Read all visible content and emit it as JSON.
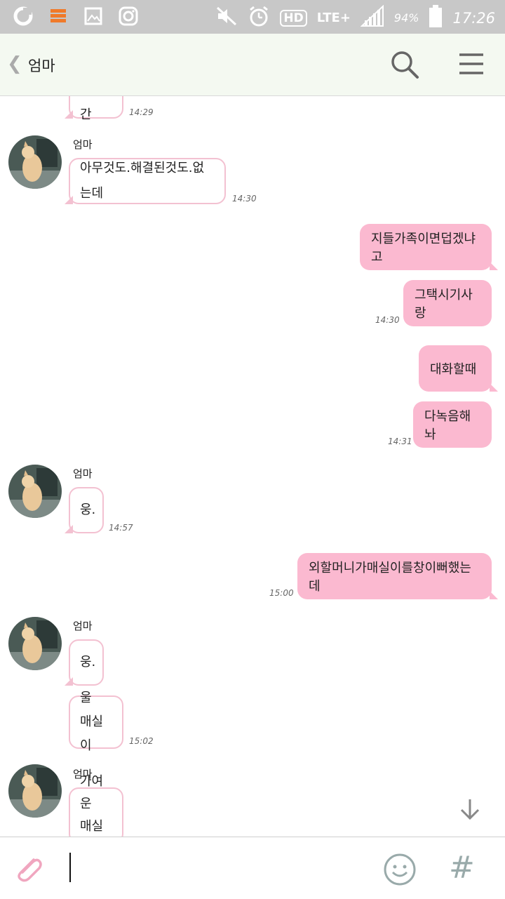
{
  "status_bar": {
    "network": "LTE+",
    "hd": "HD",
    "battery": "94%",
    "time": "17:26"
  },
  "header": {
    "back_glyph": "❮",
    "title": "엄마"
  },
  "messages": {
    "m0": {
      "text": "이시간",
      "time": "14:29"
    },
    "g1": {
      "sender": "엄마",
      "text": "아무것도.해결된것도.없는데",
      "time": "14:30"
    },
    "o1": {
      "text": "지들가족이면덥겠냐고"
    },
    "o2": {
      "text": "그택시기사랑",
      "time": "14:30"
    },
    "o3": {
      "text": "대화할때"
    },
    "o4": {
      "text": "다녹음해놔",
      "time": "14:31"
    },
    "g2": {
      "sender": "엄마",
      "text": "웅.",
      "time": "14:57"
    },
    "o5": {
      "text": "외할머니가매실이를창이뻐했는데",
      "time": "15:00"
    },
    "g3": {
      "sender": "엄마",
      "text1": "웅.",
      "text2_line1": "울",
      "text2_line2": "매실이",
      "time": "15:02"
    },
    "g4": {
      "sender": "엄마",
      "line1": "가여운",
      "line2": "매실이"
    }
  },
  "input": {
    "value": ""
  },
  "icons": [
    "clip-icon",
    "emoji-icon",
    "hash-icon",
    "search-icon",
    "menu-icon",
    "arrow-down-icon"
  ],
  "colors": {
    "outgoing_bubble": "#fbb9d0",
    "incoming_border": "#f3c1d1",
    "header_bg": "#f4f9f1"
  }
}
